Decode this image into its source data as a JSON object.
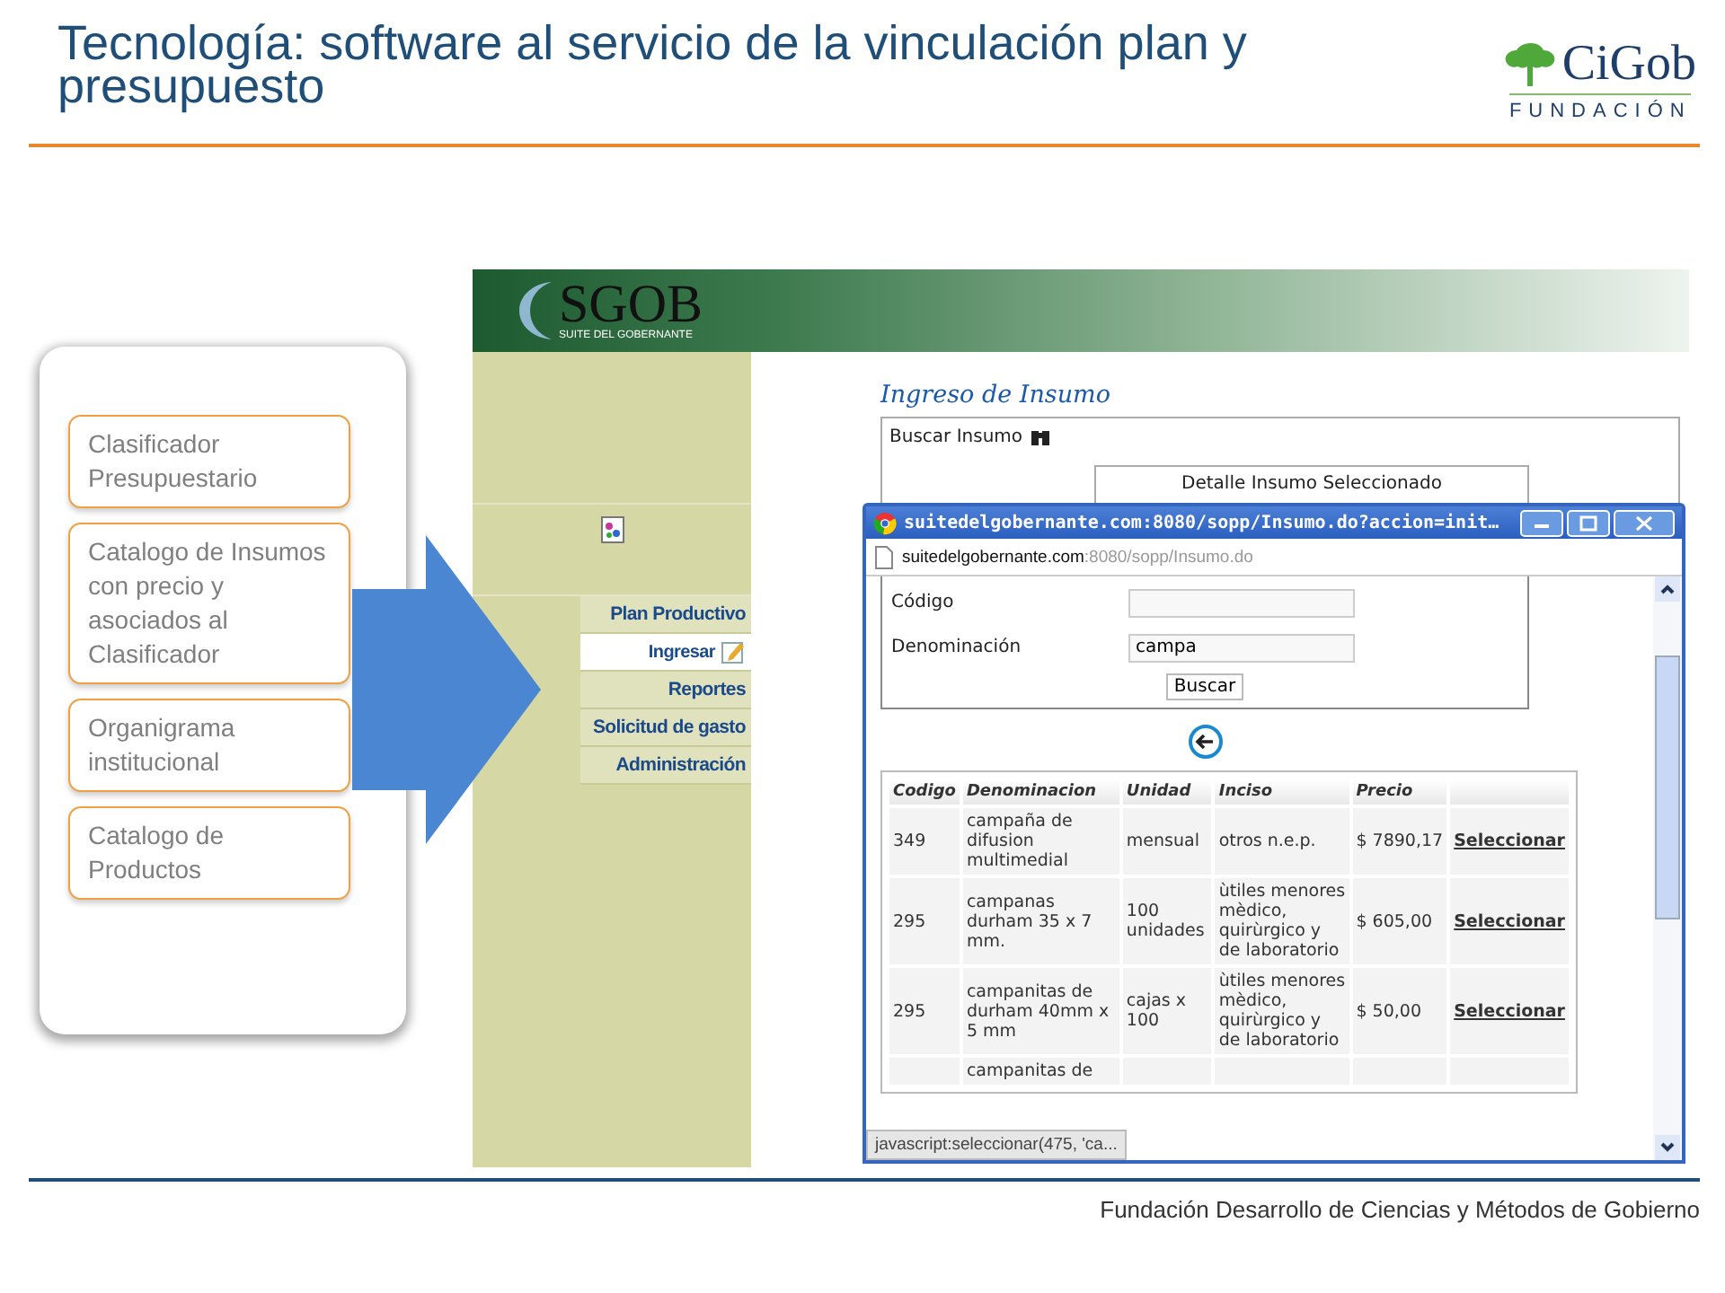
{
  "slide": {
    "title": "Tecnología: software al servicio de la vinculación plan y presupuesto"
  },
  "logo": {
    "name": "CiGob",
    "subtitle": "FUNDACIÓN"
  },
  "concept_list": [
    {
      "text": "Clasificador Presupuestario"
    },
    {
      "text": "Catalogo de Insumos  con precio y asociados al Clasificador"
    },
    {
      "text": "Organigrama institucional"
    },
    {
      "text": "Catalogo de Productos"
    }
  ],
  "app": {
    "brand": {
      "name": "SGOB",
      "tagline": "SUITE DEL GOBERNANTE"
    },
    "sidebar": {
      "items": [
        {
          "label": "Plan Productivo",
          "kind": "section",
          "selected": false
        },
        {
          "label": "Ingresar",
          "kind": "subitem",
          "selected": true
        },
        {
          "label": "Reportes",
          "kind": "section",
          "selected": false
        },
        {
          "label": "Solicitud de gasto",
          "kind": "section",
          "selected": false
        },
        {
          "label": "Administración",
          "kind": "section",
          "selected": false
        }
      ]
    },
    "page_title": "Ingreso de Insumo",
    "search_label": "Buscar Insumo",
    "detail_tab": "Detalle Insumo Seleccionado",
    "popup": {
      "title": "suitedelgobernante.com:8080/sopp/Insumo.do?accion=init…",
      "address": {
        "host": "suitedelgobernante.com",
        "path": ":8080/sopp/Insumo.do"
      },
      "fields": [
        {
          "label": "Código"
        },
        {
          "label": "Denominación",
          "value": "campa"
        }
      ],
      "button": "Buscar",
      "table": {
        "columns": [
          "Codigo",
          "Denominacion",
          "Unidad",
          "Inciso",
          "Precio"
        ],
        "rows": [
          {
            "cells": [
              "349",
              "campaña de difusion multimedial",
              "mensual",
              "otros n.e.p.",
              "$ 7890,17"
            ],
            "action": "Seleccionar"
          },
          {
            "cells": [
              "295",
              "campanas durham 35 x 7 mm.",
              "100 unidades",
              "ùtiles menores mèdico, quirùrgico y de laboratorio",
              "$ 605,00"
            ],
            "action": "Seleccionar"
          },
          {
            "cells": [
              "295",
              "campanitas de durham 40mm x 5 mm",
              "cajas x 100",
              "ùtiles menores mèdico, quirùrgico y de laboratorio",
              "$ 50,00"
            ],
            "action": "Seleccionar"
          },
          {
            "cells": [
              null,
              "campanitas de",
              null,
              null,
              null
            ]
          }
        ]
      },
      "status": "javascript:seleccionar(475, 'ca..."
    }
  },
  "footer": "Fundación Desarrollo de Ciencias y Métodos de Gobierno"
}
